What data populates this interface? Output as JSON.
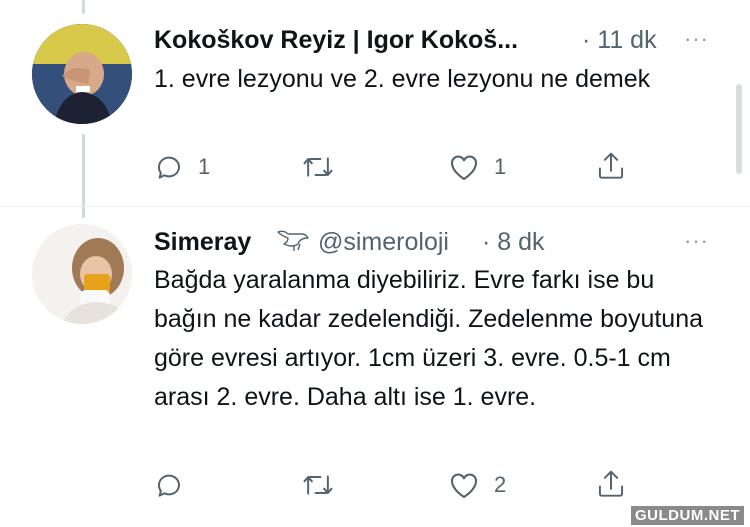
{
  "tweet1": {
    "display_name": "Kokoškov Reyiz | Igor Kokoš...",
    "time": "· 11 dk",
    "text": "1. evre lezyonu ve 2. evre lezyonu ne demek",
    "reply_count": "1",
    "like_count": "1"
  },
  "tweet2": {
    "display_name": "Simeray",
    "handle": "@simeroloji",
    "time": "· 8 dk",
    "text": "Bağda yaralanma diyebiliriz. Evre farkı ise bu bağın ne kadar zedelendiği. Zedelenme boyutuna göre evresi artıyor. 1cm üzeri 3. evre. 0.5-1 cm arası 2. evre. Daha altı ise 1. evre.",
    "reply_count": "",
    "like_count": "2"
  },
  "more_label": "···",
  "watermark": "GULDUM.NET",
  "icons": [
    "reply-icon",
    "retweet-icon",
    "like-icon",
    "share-icon",
    "bird-icon",
    "more-icon"
  ],
  "colors": {
    "text": "#0f1419",
    "secondary": "#536471",
    "line": "#cfd9de"
  }
}
